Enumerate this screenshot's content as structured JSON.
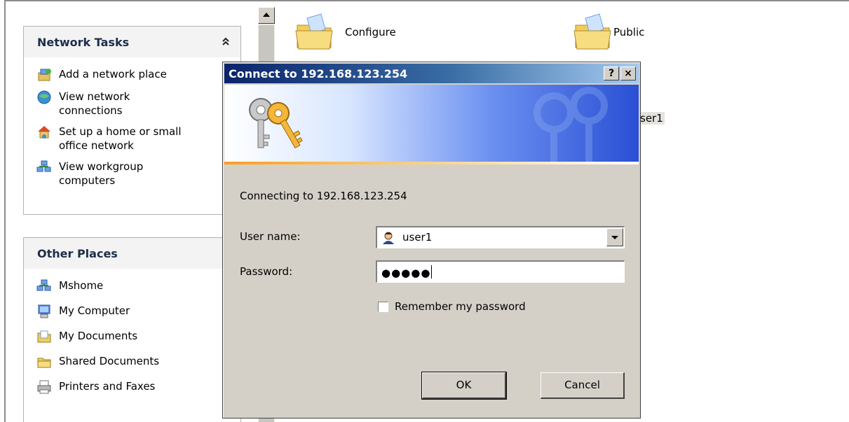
{
  "network_tasks": {
    "title": "Network Tasks",
    "items": [
      {
        "icon": "add-network-place-icon",
        "label": "Add a network place"
      },
      {
        "icon": "network-connections-icon",
        "label": "View network connections"
      },
      {
        "icon": "home-network-icon",
        "label": "Set up a home or small office network"
      },
      {
        "icon": "workgroup-icon",
        "label": "View workgroup computers"
      }
    ]
  },
  "other_places": {
    "title": "Other Places",
    "items": [
      {
        "icon": "network-icon",
        "label": "Mshome"
      },
      {
        "icon": "my-computer-icon",
        "label": "My Computer"
      },
      {
        "icon": "my-documents-icon",
        "label": "My Documents"
      },
      {
        "icon": "shared-documents-icon",
        "label": "Shared Documents"
      },
      {
        "icon": "printers-icon",
        "label": "Printers and Faxes"
      }
    ]
  },
  "files": {
    "configure": "Configure",
    "public": "Public",
    "user_partial": "ser1"
  },
  "dialog": {
    "title": "Connect to 192.168.123.254",
    "help_button": "?",
    "close_button": "×",
    "connecting_text": "Connecting to 192.168.123.254",
    "user_label": "User name:",
    "user_value": "user1",
    "password_label": "Password:",
    "password_mask": "●●●●●",
    "remember_label": "Remember my password",
    "remember_checked": false,
    "ok_label": "OK",
    "cancel_label": "Cancel"
  }
}
